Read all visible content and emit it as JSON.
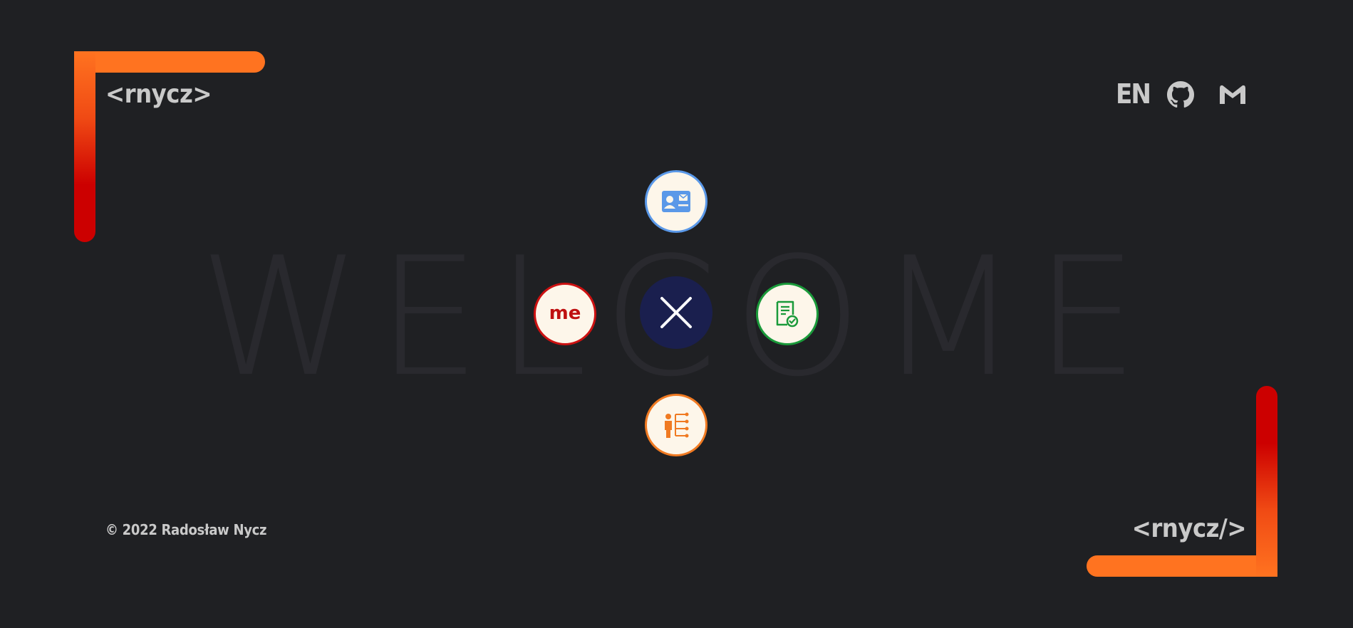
{
  "header": {
    "logo": "<rnycz>",
    "language": "EN",
    "icons": [
      "github-icon",
      "mail-icon"
    ]
  },
  "watermark": "WELCOME",
  "menu": {
    "center_icon": "close-icon",
    "items": [
      {
        "icon": "contact-card-icon",
        "color": "#5a98e8"
      },
      {
        "label": "me",
        "color": "#cc1111"
      },
      {
        "icon": "certificate-icon",
        "color": "#1a9a3a"
      },
      {
        "icon": "org-structure-icon",
        "color": "#f07a22"
      }
    ]
  },
  "footer": {
    "copyright": "© 2022 Radosław Nycz",
    "logo": "<rnycz/>"
  },
  "colors": {
    "background": "#1f2023",
    "accent_orange": "#ff7320",
    "accent_red": "#cc0000",
    "center_circle": "#1a1f4e",
    "text": "#c9c9c9"
  }
}
